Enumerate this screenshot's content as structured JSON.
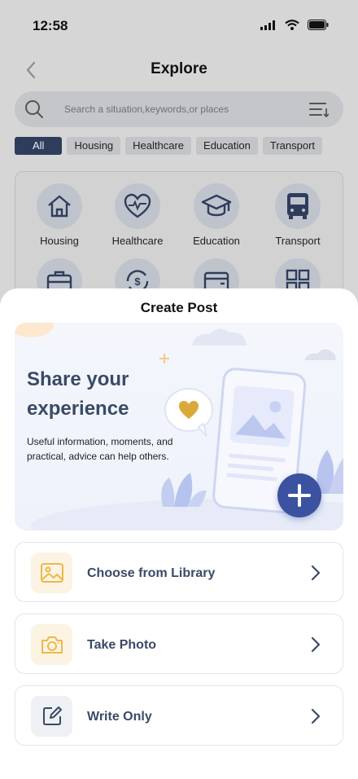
{
  "status": {
    "time": "12:58"
  },
  "header": {
    "title": "Explore"
  },
  "search": {
    "placeholder": "Search a situation,keywords,or places"
  },
  "filters": [
    "All",
    "Housing",
    "Healthcare",
    "Education",
    "Transport"
  ],
  "categories": [
    {
      "label": "Housing",
      "icon": "house-icon"
    },
    {
      "label": "Healthcare",
      "icon": "heart-pulse-icon"
    },
    {
      "label": "Education",
      "icon": "graduation-cap-icon"
    },
    {
      "label": "Transport",
      "icon": "bus-icon"
    }
  ],
  "sheet": {
    "title": "Create Post",
    "hero_title": "Share your experience",
    "hero_subtitle": "Useful information, moments, and practical, advice can help others.",
    "options": [
      {
        "label": "Choose from Library",
        "icon": "image-icon"
      },
      {
        "label": "Take Photo",
        "icon": "camera-icon"
      },
      {
        "label": "Write Only",
        "icon": "edit-icon"
      }
    ]
  },
  "colors": {
    "accent": "#3a4a66",
    "fab": "#3b52a0",
    "warm_icon": "#f0b64a",
    "heart": "#d9a93a"
  }
}
